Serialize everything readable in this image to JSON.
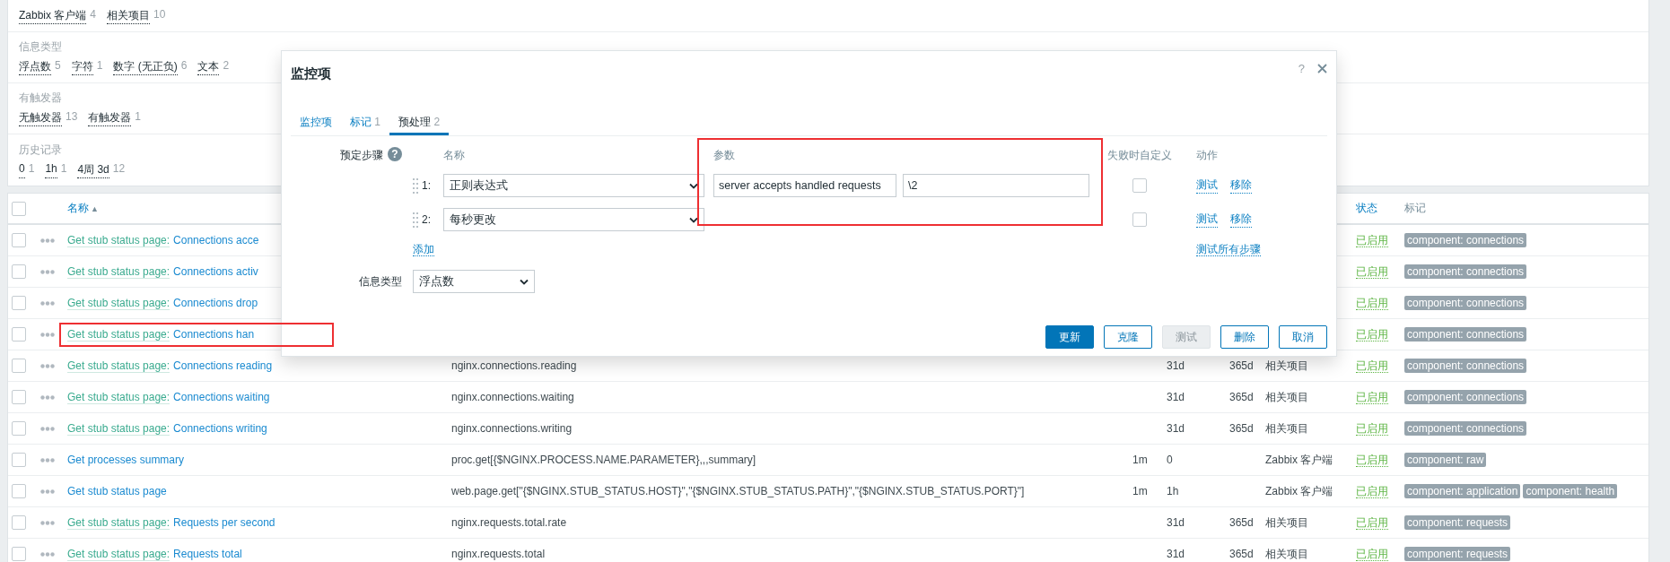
{
  "filter_sections": [
    {
      "items": [
        {
          "label": "Zabbix 客户端",
          "count": "4"
        },
        {
          "label": "相关项目",
          "count": "10"
        }
      ]
    },
    {
      "title": "信息类型",
      "items": [
        {
          "label": "浮点数",
          "count": "5"
        },
        {
          "label": "字符",
          "count": "1"
        },
        {
          "label": "数字 (无正负)",
          "count": "6"
        },
        {
          "label": "文本",
          "count": "2"
        }
      ]
    },
    {
      "title": "有触发器",
      "items": [
        {
          "label": "无触发器",
          "count": "13"
        },
        {
          "label": "有触发器",
          "count": "1"
        }
      ]
    },
    {
      "title": "历史记录",
      "items": [
        {
          "label": "0",
          "count": "1"
        },
        {
          "label": "1h",
          "count": "1"
        },
        {
          "label": "4周 3d",
          "count": "12"
        }
      ]
    }
  ],
  "table": {
    "header": {
      "checked": false,
      "name": "名称",
      "sort_mark": "▲",
      "status": "状态",
      "tags": "标记"
    },
    "rows": [
      {
        "checked": false,
        "master": "Get stub status page:",
        "name": "Connections acce",
        "status": "已启用",
        "tags": [
          "component: connections"
        ]
      },
      {
        "checked": false,
        "master": "Get stub status page:",
        "name": "Connections activ",
        "status": "已启用",
        "tags": [
          "component: connections"
        ]
      },
      {
        "checked": false,
        "master": "Get stub status page:",
        "name": "Connections drop",
        "status": "已启用",
        "tags": [
          "component: connections"
        ]
      },
      {
        "checked": false,
        "master": "Get stub status page:",
        "name": "Connections han",
        "status": "已启用",
        "tags": [
          "component: connections"
        ]
      },
      {
        "checked": false,
        "master": "Get stub status page:",
        "name": "Connections reading",
        "key": "nginx.connections.reading",
        "history": "31d",
        "trends": "365d",
        "type": "相关项目",
        "status": "已启用",
        "tags": [
          "component: connections"
        ]
      },
      {
        "checked": false,
        "master": "Get stub status page:",
        "name": "Connections waiting",
        "key": "nginx.connections.waiting",
        "history": "31d",
        "trends": "365d",
        "type": "相关项目",
        "status": "已启用",
        "tags": [
          "component: connections"
        ]
      },
      {
        "checked": false,
        "master": "Get stub status page:",
        "name": "Connections writing",
        "key": "nginx.connections.writing",
        "history": "31d",
        "trends": "365d",
        "type": "相关项目",
        "status": "已启用",
        "tags": [
          "component: connections"
        ]
      },
      {
        "checked": false,
        "name": "Get processes summary",
        "key": "proc.get[{$NGINX.PROCESS.NAME.PARAMETER},,,summary]",
        "interval": "1m",
        "history": "0",
        "type": "Zabbix 客户端",
        "status": "已启用",
        "tags": [
          "component: raw"
        ]
      },
      {
        "checked": false,
        "name": "Get stub status page",
        "key": "web.page.get[\"{$NGINX.STUB_STATUS.HOST}\",\"{$NGINX.STUB_STATUS.PATH}\",\"{$NGINX.STUB_STATUS.PORT}\"]",
        "interval": "1m",
        "history": "1h",
        "type": "Zabbix 客户端",
        "status": "已启用",
        "tags": [
          "component: application",
          "component: health"
        ]
      },
      {
        "checked": false,
        "master": "Get stub status page:",
        "name": "Requests per second",
        "key": "nginx.requests.total.rate",
        "history": "31d",
        "trends": "365d",
        "type": "相关项目",
        "status": "已启用",
        "tags": [
          "component: requests"
        ]
      },
      {
        "checked": false,
        "master": "Get stub status page:",
        "name": "Requests total",
        "key": "nginx.requests.total",
        "history": "31d",
        "trends": "365d",
        "type": "相关项目",
        "status": "已启用",
        "tags": [
          "component: requests"
        ]
      }
    ]
  },
  "dialog": {
    "title": "监控项",
    "help": "?",
    "tabs": [
      {
        "label": "监控项",
        "selected": false
      },
      {
        "label": "标记",
        "count": "1",
        "selected": false
      },
      {
        "label": "预处理",
        "count": "2",
        "selected": true
      }
    ],
    "steps_label": "预定步骤",
    "steps_help": "?",
    "columns": {
      "name": "名称",
      "params": "参数",
      "on_fail": "失败时自定义",
      "actions": "动作"
    },
    "steps": [
      {
        "index": "1:",
        "type": "正则表达式",
        "params": [
          "server accepts handled requests",
          "\\2"
        ],
        "on_fail": false,
        "actions": [
          "测试",
          "移除"
        ]
      },
      {
        "index": "2:",
        "type": "每秒更改",
        "on_fail": false,
        "actions": [
          "测试",
          "移除"
        ]
      }
    ],
    "add_link": "添加",
    "test_all_link": "测试所有步骤",
    "info_type_label": "信息类型",
    "info_type": "浮点数",
    "buttons": [
      {
        "label": "更新",
        "kind": "primary",
        "disabled": false
      },
      {
        "label": "克隆",
        "kind": "secondary",
        "disabled": false
      },
      {
        "label": "测试",
        "kind": "secondary",
        "disabled": true
      },
      {
        "label": "删除",
        "kind": "secondary",
        "disabled": false
      },
      {
        "label": "取消",
        "kind": "secondary",
        "disabled": false
      }
    ]
  }
}
